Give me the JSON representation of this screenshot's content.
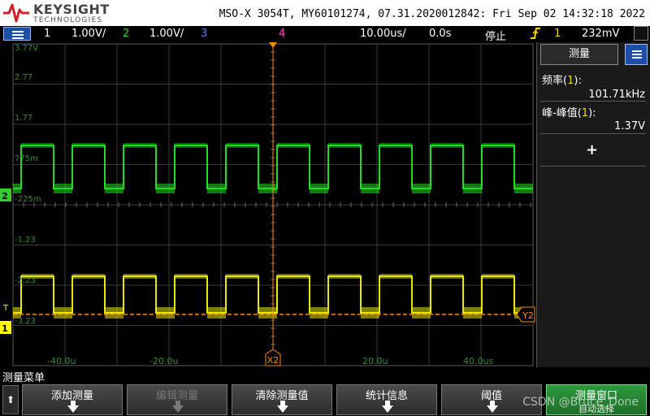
{
  "header": {
    "brand": "KEYSIGHT",
    "brand_sub": "TECHNOLOGIES",
    "title": "MSO-X 3054T, MY60101274, 07.31.2020012842: Fri Sep 02 14:32:18 2022"
  },
  "status_bar": {
    "ch1_num": "1",
    "ch1_scale": "1.00V/",
    "ch2_num": "2",
    "ch2_scale": "1.00V/",
    "ch3_num": "3",
    "ch4_num": "4",
    "timebase": "10.00us/",
    "delay": "0.0s",
    "run_state": "停止",
    "trigger_icon": "trigger-edge-icon",
    "trigger_ch": "1",
    "trigger_level": "232mV",
    "colors": {
      "ch1": "#ffff00",
      "ch2": "#33cc33",
      "ch3": "#4a7dff",
      "ch4": "#ff4fd0"
    }
  },
  "plot": {
    "y_labels": [
      "3.77V",
      "2.77",
      "1.77",
      "775m",
      "-225m",
      "-1.23",
      "-2.23",
      "-3.23"
    ],
    "x_labels": [
      "-40.0u",
      "-20.0u",
      "20.0u",
      "40.0us"
    ],
    "markers": {
      "ch2_ground": "2",
      "trigger_marker": "T",
      "ch1_ground": "1",
      "cursor_x2": "X2",
      "cursor_y2": "Y2"
    },
    "colors": {
      "grid": "#3a3a3a",
      "ch1_trace": "#e8e800",
      "ch2_trace": "#22dd22",
      "cursor": "#ff8c00"
    }
  },
  "side_panel": {
    "tab_label": "测量",
    "measurements": [
      {
        "name": "频率",
        "channel": "1",
        "value": "101.71kHz"
      },
      {
        "name": "峰-峰值",
        "channel": "1",
        "value": "1.37V"
      }
    ],
    "add_icon": "plus-icon"
  },
  "softkeys": {
    "title": "测量菜单",
    "back_icon": "up-arrow-icon",
    "keys": [
      {
        "label": "添加测量",
        "enabled": true
      },
      {
        "label": "编辑测量",
        "enabled": false
      },
      {
        "label": "清除测量值",
        "enabled": true
      },
      {
        "label": "统计信息",
        "enabled": true
      },
      {
        "label": "阈值",
        "enabled": true
      },
      {
        "label": "测量窗口",
        "label2": "自动选择",
        "enabled": true
      }
    ],
    "watermark": "CSDN @Bruce_Done"
  }
}
